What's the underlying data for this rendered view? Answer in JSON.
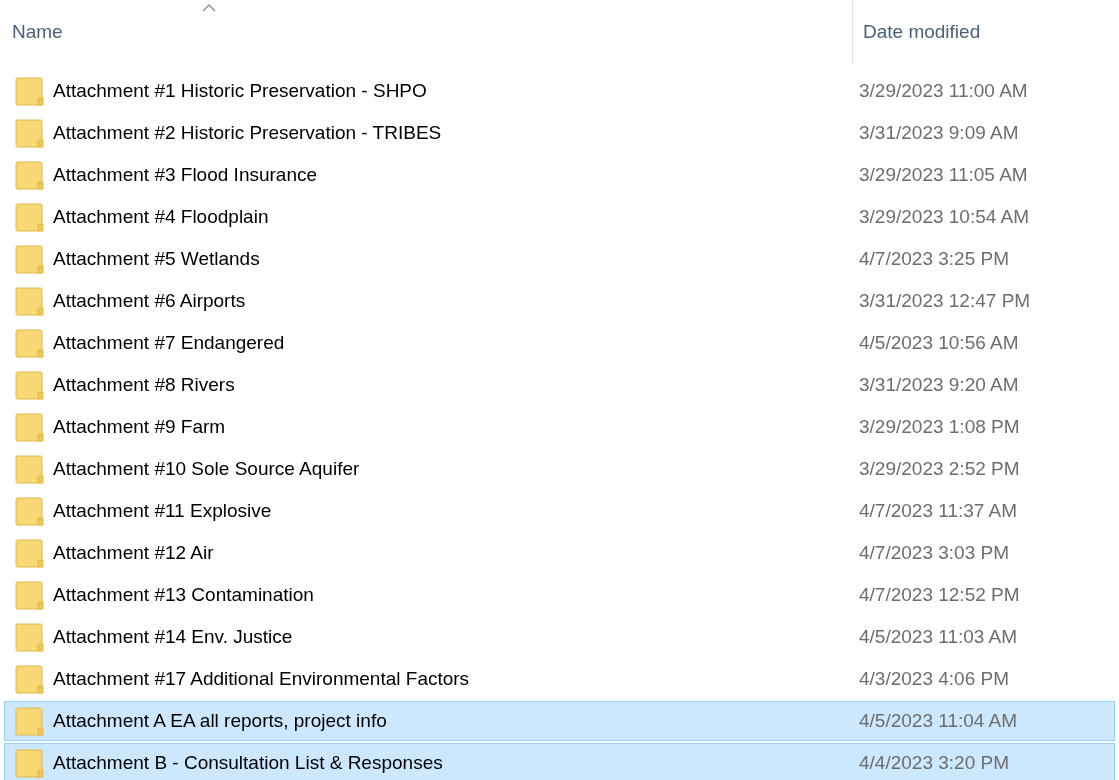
{
  "columns": [
    {
      "label": "Name",
      "sorted": true
    },
    {
      "label": "Date modified",
      "sorted": false
    }
  ],
  "rows": [
    {
      "name": "Attachment #1 Historic Preservation - SHPO",
      "date": "3/29/2023 11:00 AM",
      "selected": false
    },
    {
      "name": "Attachment #2 Historic Preservation - TRIBES",
      "date": "3/31/2023 9:09 AM",
      "selected": false
    },
    {
      "name": "Attachment #3 Flood Insurance",
      "date": "3/29/2023 11:05 AM",
      "selected": false
    },
    {
      "name": "Attachment #4 Floodplain",
      "date": "3/29/2023 10:54 AM",
      "selected": false
    },
    {
      "name": "Attachment #5 Wetlands",
      "date": "4/7/2023 3:25 PM",
      "selected": false
    },
    {
      "name": "Attachment #6 Airports",
      "date": "3/31/2023 12:47 PM",
      "selected": false
    },
    {
      "name": "Attachment #7 Endangered",
      "date": "4/5/2023 10:56 AM",
      "selected": false
    },
    {
      "name": "Attachment #8 Rivers",
      "date": "3/31/2023 9:20 AM",
      "selected": false
    },
    {
      "name": "Attachment #9 Farm",
      "date": "3/29/2023 1:08 PM",
      "selected": false
    },
    {
      "name": "Attachment #10 Sole Source Aquifer",
      "date": "3/29/2023 2:52 PM",
      "selected": false
    },
    {
      "name": "Attachment #11 Explosive",
      "date": "4/7/2023 11:37 AM",
      "selected": false
    },
    {
      "name": "Attachment #12 Air",
      "date": "4/7/2023 3:03 PM",
      "selected": false
    },
    {
      "name": "Attachment #13 Contamination",
      "date": "4/7/2023 12:52 PM",
      "selected": false
    },
    {
      "name": "Attachment #14 Env. Justice",
      "date": "4/5/2023 11:03 AM",
      "selected": false
    },
    {
      "name": "Attachment #17 Additional Environmental Factors",
      "date": "4/3/2023 4:06 PM",
      "selected": false
    },
    {
      "name": "Attachment A EA all reports, project info",
      "date": "4/5/2023 11:04 AM",
      "selected": true
    },
    {
      "name": "Attachment B - Consultation List & Responses",
      "date": "4/4/2023 3:20 PM",
      "selected": true
    }
  ]
}
